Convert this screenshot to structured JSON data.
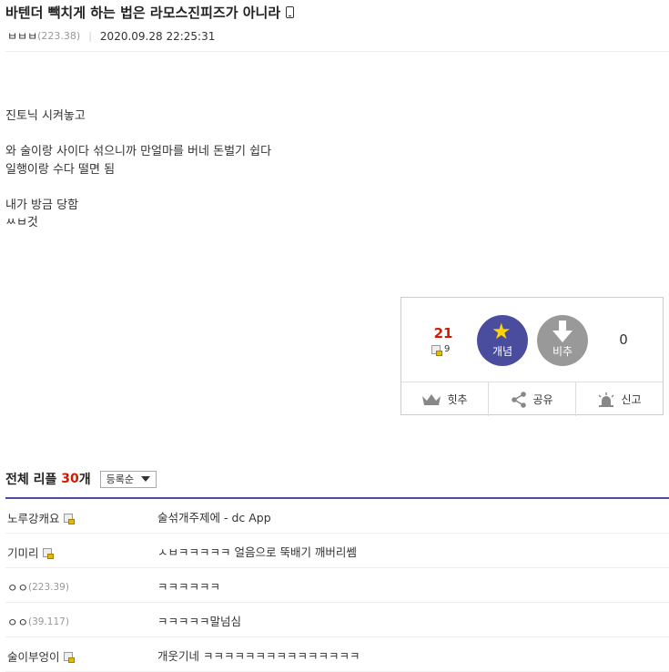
{
  "post": {
    "title": "바텐더 빽치게 하는 법은 라모스진피즈가 아니라",
    "author": "ㅂㅂㅂ",
    "author_ip": "(223.38)",
    "datetime": "2020.09.28 22:25:31",
    "body_lines": [
      "진토닉 시켜놓고",
      "",
      "와 술이랑 사이다 섞으니까 만얼마를 버네 돈벌기 쉽다",
      "일행이랑 수다 떨면 됨",
      "",
      "내가 방금 당함",
      "ㅆㅂ것"
    ]
  },
  "vote": {
    "up_count": "21",
    "fixed_count": "9",
    "up_label": "개념",
    "down_label": "비추",
    "down_count": "0",
    "actions": [
      "힛추",
      "공유",
      "신고"
    ]
  },
  "comments": {
    "heading": "전체 리플",
    "count": "30",
    "count_suffix": "개",
    "sort_label": "등록순",
    "items": [
      {
        "nick": "노루강캐요",
        "ip": "",
        "fixed": true,
        "text": "술섞개주제에 - dc App"
      },
      {
        "nick": "기미리",
        "ip": "",
        "fixed": true,
        "text": "ㅅㅂㅋㅋㅋㅋㅋ 얼음으로 뚝배기 깨버리쎔"
      },
      {
        "nick": "ㅇㅇ",
        "ip": "(223.39)",
        "fixed": false,
        "text": "ㅋㅋㅋㅋㅋㅋ"
      },
      {
        "nick": "ㅇㅇ",
        "ip": "(39.117)",
        "fixed": false,
        "text": "ㅋㅋㅋㅋㅋ말넘심"
      },
      {
        "nick": "술이부엉이",
        "ip": "",
        "fixed": true,
        "text": "개웃기네 ㅋㅋㅋㅋㅋㅋㅋㅋㅋㅋㅋㅋㅋㅋㅋ"
      }
    ]
  },
  "colors": {
    "accent": "#4a4d9e",
    "count_red": "#d31900"
  }
}
